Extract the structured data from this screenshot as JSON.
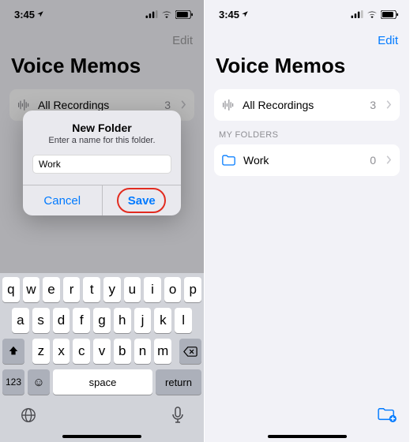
{
  "left": {
    "status": {
      "time": "3:45",
      "loc_icon": "location"
    },
    "edit_label": "Edit",
    "title": "Voice Memos",
    "row_all": {
      "label": "All Recordings",
      "count": "3"
    },
    "dialog": {
      "title": "New Folder",
      "subtitle": "Enter a name for this folder.",
      "input_value": "Work",
      "cancel": "Cancel",
      "save": "Save"
    },
    "keyboard": {
      "row1": [
        "q",
        "w",
        "e",
        "r",
        "t",
        "y",
        "u",
        "i",
        "o",
        "p"
      ],
      "row2": [
        "a",
        "s",
        "d",
        "f",
        "g",
        "h",
        "j",
        "k",
        "l"
      ],
      "row3": [
        "z",
        "x",
        "c",
        "v",
        "b",
        "n",
        "m"
      ],
      "num": "123",
      "space": "space",
      "return": "return"
    }
  },
  "right": {
    "status": {
      "time": "3:45"
    },
    "edit_label": "Edit",
    "title": "Voice Memos",
    "row_all": {
      "label": "All Recordings",
      "count": "3"
    },
    "section_header": "MY FOLDERS",
    "row_work": {
      "label": "Work",
      "count": "0"
    }
  }
}
